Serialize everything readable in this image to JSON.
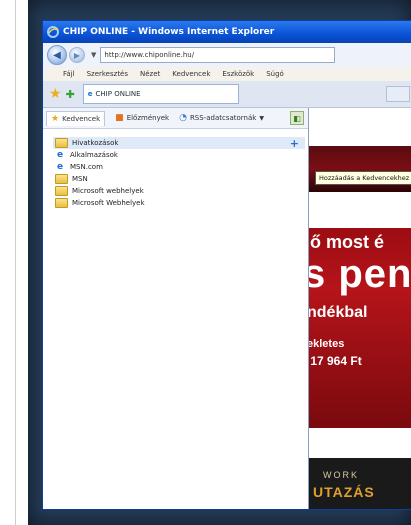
{
  "window": {
    "title": "CHIP ONLINE - Windows Internet Explorer"
  },
  "address": {
    "url": "http://www.chiponline.hu/"
  },
  "menu": [
    "Fájl",
    "Szerkesztés",
    "Nézet",
    "Kedvencek",
    "Eszközök",
    "Súgó"
  ],
  "tab": {
    "label": "CHIP ONLINE"
  },
  "favorites_center": {
    "tabs": [
      "Kedvencek",
      "Előzmények",
      "RSS-adatcsatornák"
    ],
    "items": [
      {
        "label": "Hivatkozások",
        "type": "folder"
      },
      {
        "label": "Alkalmazások",
        "type": "page"
      },
      {
        "label": "MSN.com",
        "type": "page"
      },
      {
        "label": "MSN",
        "type": "folder"
      },
      {
        "label": "Microsoft webhelyek",
        "type": "folder"
      },
      {
        "label": "Microsoft Webhelyek",
        "type": "folder"
      }
    ],
    "tooltip": "Hozzáadás a Kedvencekhez"
  },
  "ad": {
    "line1": "lő most é",
    "line2": "s pen",
    "line3": "ndékbal",
    "line4": "ekletes",
    "line5": ": 17 964 Ft",
    "bottom1": "WORK",
    "bottom2": "UTAZÁS"
  }
}
